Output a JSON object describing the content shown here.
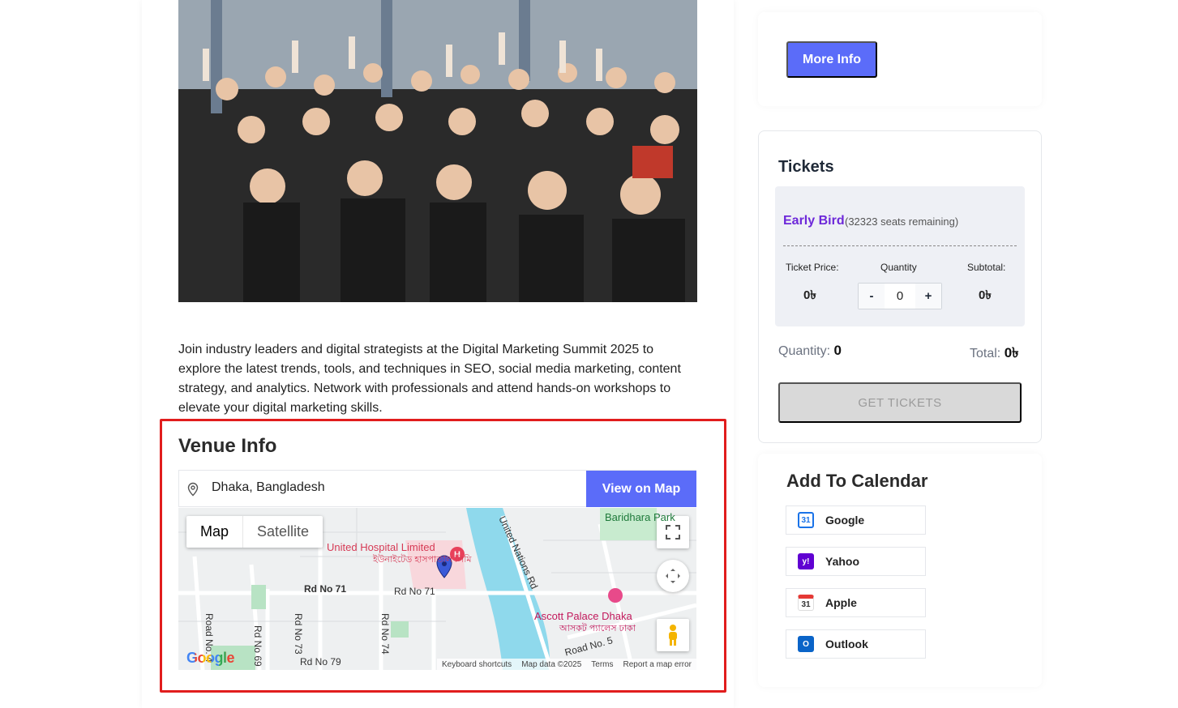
{
  "description": "Join industry leaders and digital strategists at the Digital Marketing Summit 2025 to explore the latest trends, tools, and techniques in SEO, social media marketing, content strategy, and analytics. Network with professionals and attend hands-on workshops to elevate your digital marketing skills.",
  "venue": {
    "title": "Venue Info",
    "address": "Dhaka, Bangladesh",
    "view_map_label": "View on Map"
  },
  "map": {
    "type_map": "Map",
    "type_satellite": "Satellite",
    "labels": {
      "hospital_en": "United Hospital Limited",
      "hospital_bn": "ইউনাইটেড হাসপাতাল লিমি",
      "rd71_a": "Rd No 71",
      "rd71_b": "Rd No 71",
      "rd73": "Rd No 73",
      "rd74": "Rd No 74",
      "rd69": "Rd No 69",
      "rd79": "Rd No 79",
      "road4": "Road No. 4",
      "road5": "Road No. 5",
      "un_rd": "United Nations Rd",
      "baridhara": "Baridhara Park",
      "ascott_en": "Ascott Palace Dhaka",
      "ascott_bn": "আসকট প্যালেস ঢাকা"
    },
    "footer": {
      "shortcuts": "Keyboard shortcuts",
      "data": "Map data ©2025",
      "terms": "Terms",
      "report": "Report a map error"
    },
    "logo": "Google"
  },
  "sidebar": {
    "more_info_label": "More Info",
    "tickets": {
      "title": "Tickets",
      "tier_name": "Early Bird",
      "tier_remaining": "(32323 seats remaining)",
      "price_label": "Ticket Price:",
      "quantity_label": "Quantity",
      "subtotal_label": "Subtotal:",
      "price_value": "0৳",
      "quantity_value": "0",
      "subtotal_value": "0৳",
      "minus": "-",
      "plus": "+",
      "summary_quantity_label": "Quantity:",
      "summary_quantity_value": "0",
      "summary_total_label": "Total:",
      "summary_total_value": "0৳",
      "get_tickets_label": "GET TICKETS"
    },
    "calendar": {
      "title": "Add To Calendar",
      "items": [
        {
          "label": "Google",
          "icon": "google-calendar-icon",
          "color": "#1a73e8"
        },
        {
          "label": "Yahoo",
          "icon": "yahoo-icon",
          "color": "#6001d2"
        },
        {
          "label": "Apple",
          "icon": "apple-calendar-icon",
          "color": "#e53935"
        },
        {
          "label": "Outlook",
          "icon": "outlook-icon",
          "color": "#0a64c8"
        }
      ]
    }
  },
  "colors": {
    "accent": "#5b6cf9",
    "tier": "#6d28d9",
    "highlight": "#e11d1d"
  }
}
